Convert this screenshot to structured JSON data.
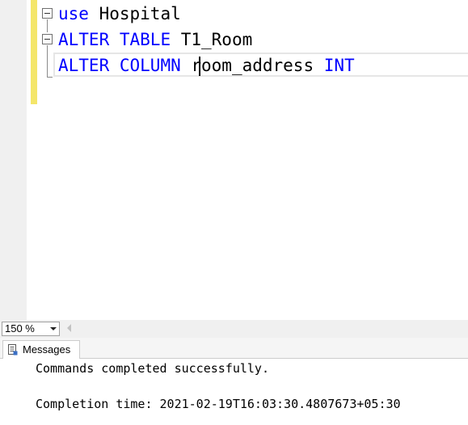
{
  "editor": {
    "lines": [
      [
        {
          "text": "use",
          "kind": "keyword"
        },
        {
          "text": " Hospital",
          "kind": "plain"
        }
      ],
      [
        {
          "text": "ALTER",
          "kind": "keyword"
        },
        {
          "text": " ",
          "kind": "plain"
        },
        {
          "text": "TABLE",
          "kind": "keyword"
        },
        {
          "text": " T1_Room",
          "kind": "plain"
        }
      ],
      [
        {
          "text": "ALTER",
          "kind": "keyword"
        },
        {
          "text": " ",
          "kind": "plain"
        },
        {
          "text": "COLUMN",
          "kind": "keyword"
        },
        {
          "text": " room_address ",
          "kind": "plain"
        },
        {
          "text": "INT",
          "kind": "keyword"
        }
      ]
    ],
    "keyword_color": "#0000ff",
    "change_marker_color": "#f4e66a"
  },
  "statusbar": {
    "zoom_value": "150 %",
    "zoom_icon": "chevron-down-icon",
    "scroll_icon": "scroll-left-icon"
  },
  "results": {
    "tab_label": "Messages",
    "tab_icon": "messages-icon",
    "message_line_1": "Commands completed successfully.",
    "message_line_2": "Completion time: 2021-02-19T16:03:30.4807673+05:30"
  }
}
